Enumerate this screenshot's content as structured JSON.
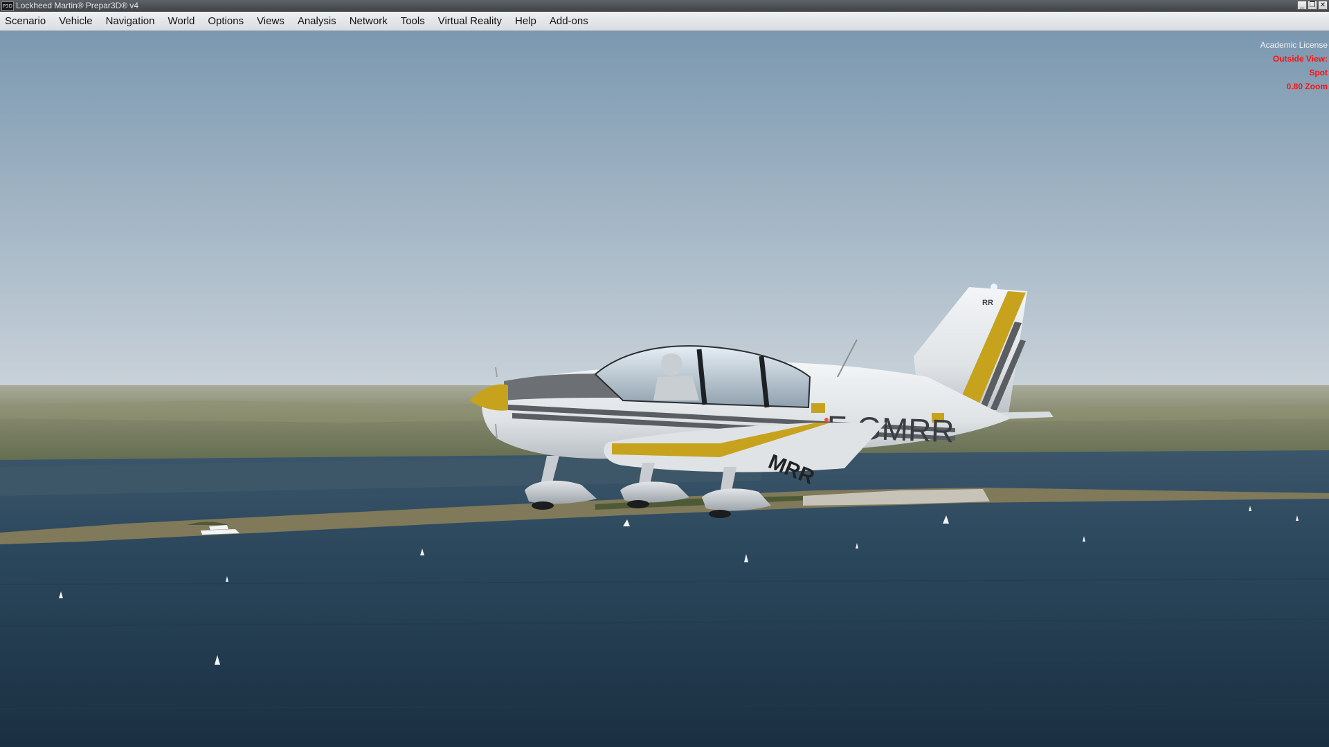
{
  "window": {
    "title": "Lockheed Martin® Prepar3D® v4",
    "icon_label": "P3D",
    "controls": {
      "minimize_glyph": "_",
      "restore_glyph": "❐",
      "close_glyph": "✕"
    }
  },
  "menu": {
    "items": [
      {
        "label": "Scenario"
      },
      {
        "label": "Vehicle"
      },
      {
        "label": "Navigation"
      },
      {
        "label": "World"
      },
      {
        "label": "Options"
      },
      {
        "label": "Views"
      },
      {
        "label": "Analysis"
      },
      {
        "label": "Network"
      },
      {
        "label": "Tools"
      },
      {
        "label": "Virtual Reality"
      },
      {
        "label": "Help"
      },
      {
        "label": "Add-ons"
      }
    ]
  },
  "hud": {
    "license": "Academic License",
    "view_label": "Outside View:",
    "view_mode": "Spot",
    "zoom": "0.80 Zoom"
  },
  "aircraft": {
    "registration": "F-GMRR",
    "fin_code": "RR",
    "belly_code": "MRR",
    "colors": {
      "body": "#e9ecef",
      "stripe": "#5a5e62",
      "accent": "#c7a21d"
    }
  },
  "colors": {
    "sky_top": "#7d9ab2",
    "sky_horizon": "#c4cfd8",
    "land": "#7d7f62",
    "water": "#243d52",
    "hud_red": "#ff1010"
  }
}
